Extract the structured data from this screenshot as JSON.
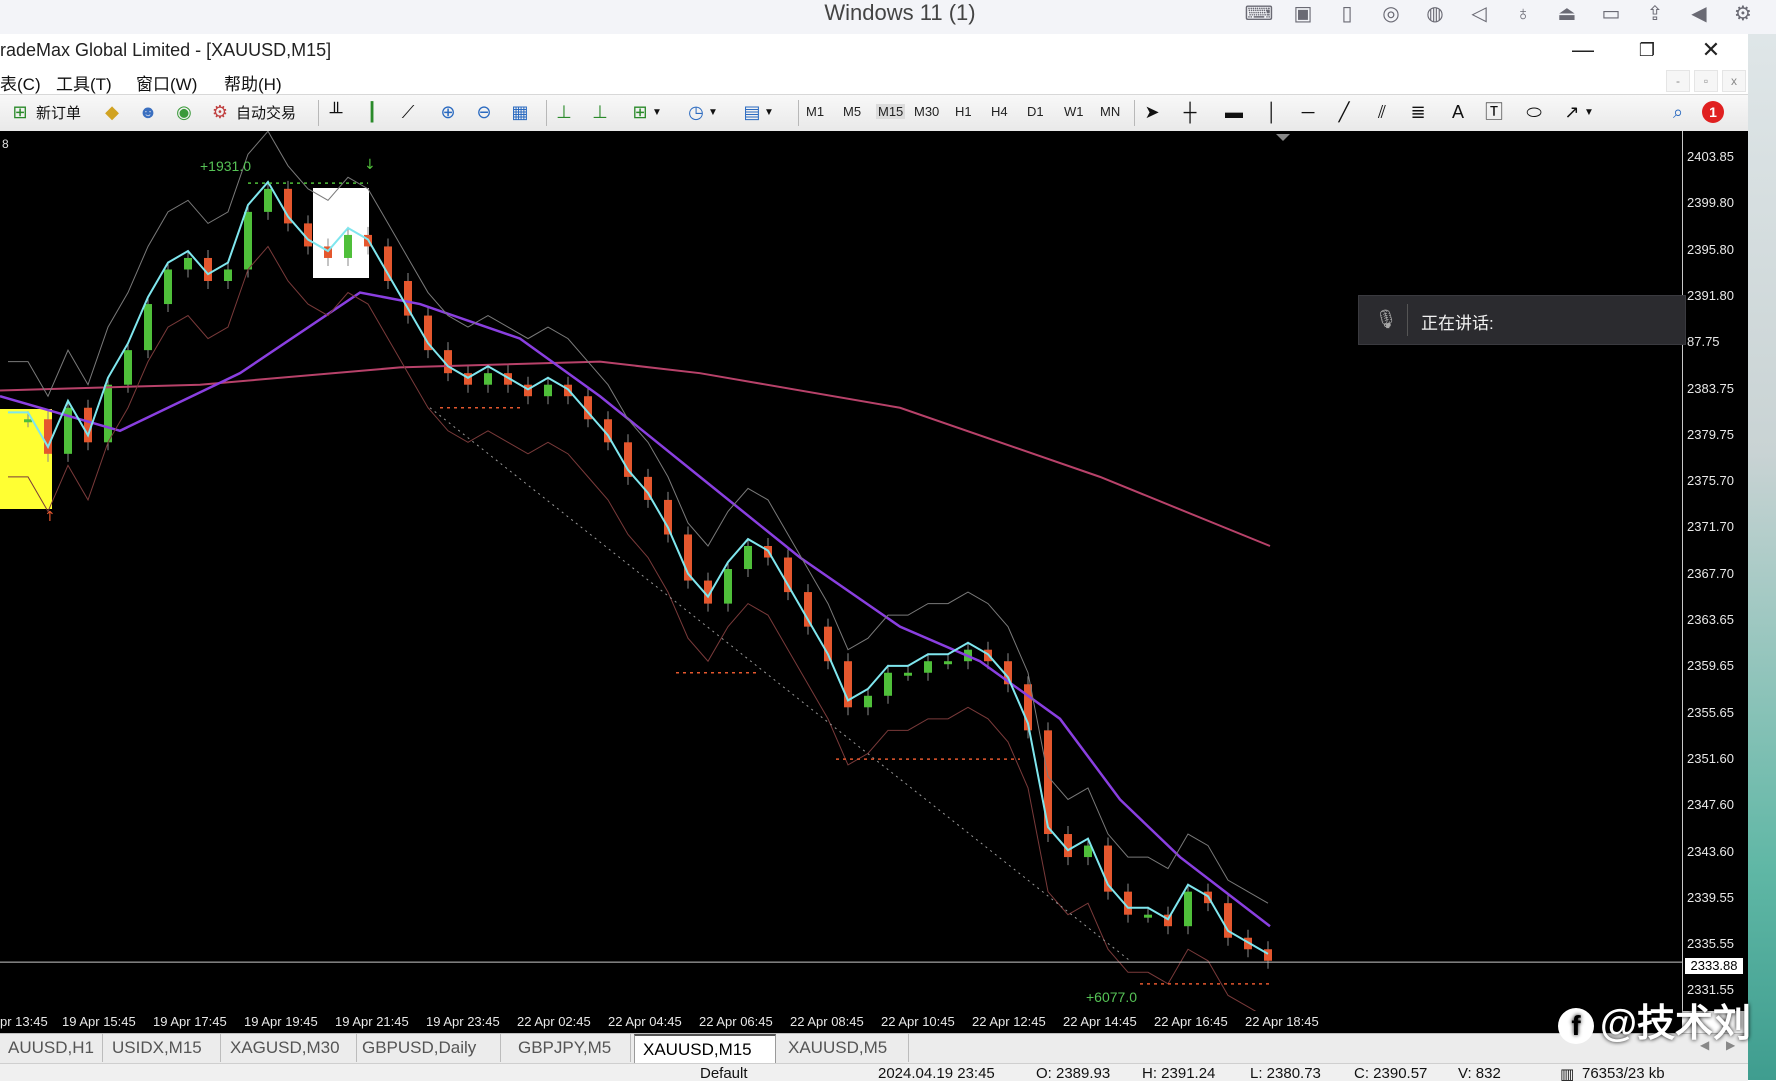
{
  "remote_session": {
    "title": "Windows 11 (1)",
    "icons": [
      "keyboard-icon",
      "chip-icon",
      "usb-icon",
      "speed-icon",
      "globe-icon",
      "speaker-icon",
      "microphone-icon",
      "drive-icon",
      "camera-icon",
      "share-icon",
      "back-icon",
      "gear-icon"
    ]
  },
  "window": {
    "title": "radeMax Global Limited - [XAUUSD,M15]",
    "minimize": "—",
    "restore": "❐",
    "close": "✕"
  },
  "menu": {
    "items": [
      "表(C)",
      "工具(T)",
      "窗口(W)",
      "帮助(H)"
    ]
  },
  "toolbar": {
    "new_order": "新订单",
    "auto_trade": "自动交易",
    "timeframes": [
      "M1",
      "M5",
      "M15",
      "M30",
      "H1",
      "H4",
      "D1",
      "W1",
      "MN"
    ],
    "text_tool": "A",
    "notification_count": "1"
  },
  "chart": {
    "symbol_line": "8",
    "top_annotation": "+1931.0",
    "bottom_annotation": "+6077.0",
    "price_labels": [
      "2403.85",
      "2399.80",
      "2395.80",
      "2391.80",
      "87.75",
      "2383.75",
      "2379.75",
      "2375.70",
      "2371.70",
      "2367.70",
      "2363.65",
      "2359.65",
      "2355.65",
      "2351.60",
      "2347.60",
      "2343.60",
      "2339.55",
      "2335.55",
      "2331.55"
    ],
    "current_price": "2333.88",
    "time_labels": [
      "pr 13:45",
      "19 Apr 15:45",
      "19 Apr 17:45",
      "19 Apr 19:45",
      "19 Apr 21:45",
      "19 Apr 23:45",
      "22 Apr 02:45",
      "22 Apr 04:45",
      "22 Apr 06:45",
      "22 Apr 08:45",
      "22 Apr 10:45",
      "22 Apr 12:45",
      "22 Apr 14:45",
      "22 Apr 16:45",
      "22 Apr 18:45"
    ],
    "colors": {
      "bull": "#4fbf3a",
      "bear": "#e4572e",
      "fast_ma": "#7fe6ee",
      "mid_ma": "#8a3fe0",
      "slow_ma": "#b8426a",
      "highlight_yellow": "#ffff33",
      "highlight_white": "#ffffff"
    }
  },
  "voice_popup": {
    "label": "正在讲话:"
  },
  "tabs": [
    "AUUSD,H1",
    "USIDX,M15",
    "XAGUSD,M30",
    "GBPUSD,Daily",
    "GBPJPY,M5",
    "XAUUSD,M15",
    "XAUUSD,M5"
  ],
  "active_tab": "XAUUSD,M15",
  "status_bar": {
    "profile": "Default",
    "datetime": "2024.04.19 23:45",
    "open": "O: 2389.93",
    "high": "H: 2391.24",
    "low": "L: 2380.73",
    "close": "C: 2390.57",
    "volume": "V: 832",
    "traffic": "76353/23 kb"
  },
  "watermark": "@技术刘"
}
